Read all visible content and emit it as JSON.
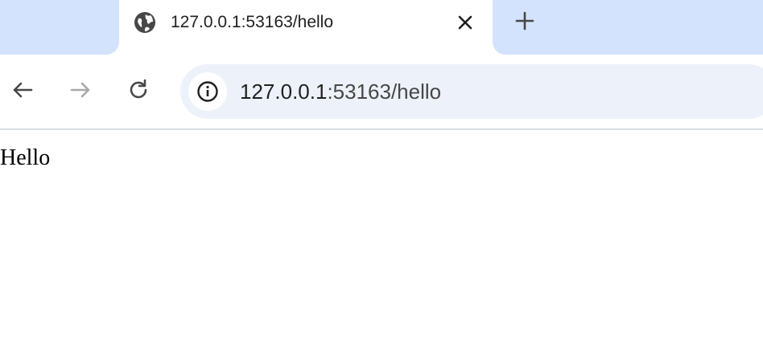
{
  "tab": {
    "title": "127.0.0.1:53163/hello",
    "favicon": "globe-icon",
    "close_icon": "close-icon"
  },
  "new_tab": {
    "icon": "plus-icon"
  },
  "toolbar": {
    "back_icon": "arrow-left-icon",
    "forward_icon": "arrow-right-icon",
    "reload_icon": "reload-icon"
  },
  "omnibox": {
    "host": "127.0.0.1",
    "path": ":53163/hello",
    "site_info_icon": "info-icon"
  },
  "page": {
    "text": "Hello"
  },
  "colors": {
    "tabstrip": "#d3e3fd",
    "omnibox": "#edf2fa",
    "divider": "#dadce0"
  }
}
